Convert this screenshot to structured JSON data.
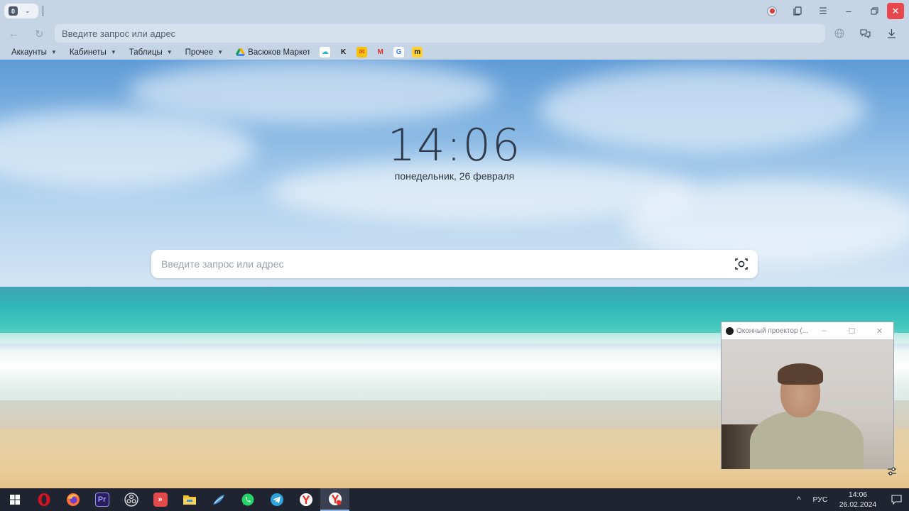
{
  "browser": {
    "tab_count": "0",
    "address_placeholder": "Введите запрос или адрес",
    "bookmarks": [
      {
        "label": "Аккаунты"
      },
      {
        "label": "Кабинеты"
      },
      {
        "label": "Таблицы"
      },
      {
        "label": "Прочее"
      }
    ],
    "bookmark_site": "Васюков Маркетинг",
    "favicons": [
      {
        "name": "cloud-favicon",
        "glyph": "☁",
        "bg": "#ffffff",
        "fg": "#2bb5c9"
      },
      {
        "name": "k-favicon",
        "glyph": "K",
        "bg": "transparent",
        "fg": "#111111"
      },
      {
        "name": "mail-envelope-favicon",
        "glyph": "✉",
        "bg": "#f4c20d",
        "fg": "#d6342b"
      },
      {
        "name": "gmail-favicon",
        "glyph": "M",
        "bg": "transparent",
        "fg": "#d93025"
      },
      {
        "name": "google-favicon",
        "glyph": "G",
        "bg": "#ffffff",
        "fg": "#4285f4"
      },
      {
        "name": "miro-favicon",
        "glyph": "m",
        "bg": "#ffd02f",
        "fg": "#111111"
      }
    ]
  },
  "newtab": {
    "time": "14:06",
    "date": "понедельник, 26 февраля",
    "search_placeholder": "Введите запрос или адрес"
  },
  "projector": {
    "title": "Оконный проектор (..."
  },
  "taskbar": {
    "apps": [
      {
        "name": "start-button",
        "glyph": "",
        "bg": "transparent"
      },
      {
        "name": "opera-taskbar-icon",
        "glyph": "O",
        "bg": "#d3141e"
      },
      {
        "name": "firefox-taskbar-icon",
        "glyph": "",
        "bg": "#ff7139"
      },
      {
        "name": "premiere-taskbar-icon",
        "glyph": "Pr",
        "bg": "#2a1b5a"
      },
      {
        "name": "obs-taskbar-icon",
        "glyph": "",
        "bg": "#2b2e38"
      },
      {
        "name": "anydesk-taskbar-icon",
        "glyph": "»",
        "bg": "#e34a4a"
      },
      {
        "name": "file-explorer-taskbar-icon",
        "glyph": "",
        "bg": "#f2c230"
      },
      {
        "name": "feather-app-taskbar-icon",
        "glyph": "",
        "bg": "#3c8fd6"
      },
      {
        "name": "whatsapp-taskbar-icon",
        "glyph": "✆",
        "bg": "#25d366"
      },
      {
        "name": "telegram-taskbar-icon",
        "glyph": "➤",
        "bg": "#2aa3df"
      },
      {
        "name": "yandex-browser-taskbar-icon",
        "glyph": "Y",
        "bg": "#ffffff"
      },
      {
        "name": "yandex-browser-active-taskbar-icon",
        "glyph": "Y",
        "bg": "#ffffff"
      }
    ],
    "language": "РУС",
    "time": "14:06",
    "date": "26.02.2024"
  }
}
